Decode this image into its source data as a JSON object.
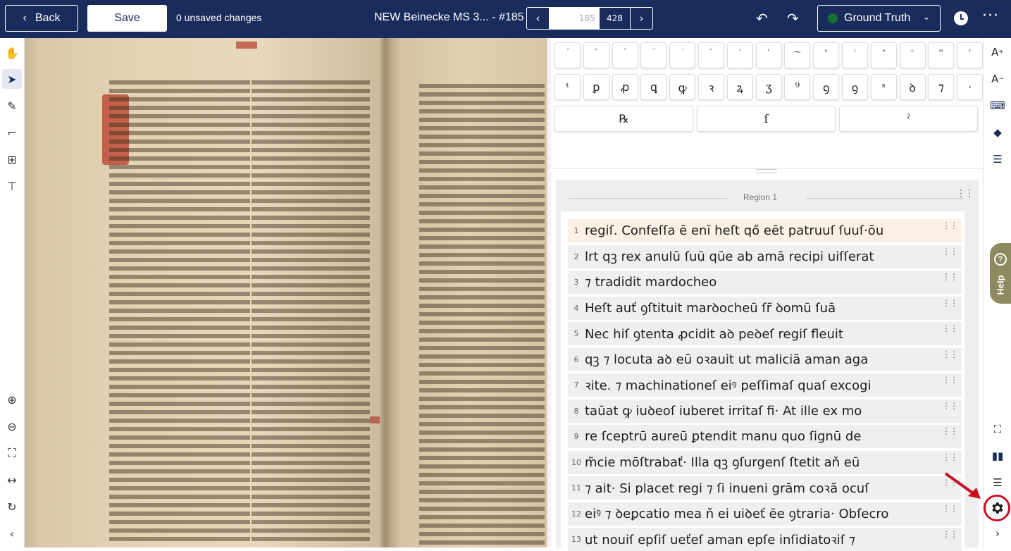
{
  "topbar": {
    "back_label": "Back",
    "save_label": "Save",
    "unsaved": "0 unsaved changes",
    "doc_title": "NEW Beinecke MS 3... - #185",
    "page_current": "185",
    "page_total": "428",
    "version_label": "Ground Truth",
    "colors": {
      "bar": "#1a2c5c",
      "status_dot": "#17702e"
    }
  },
  "left_tools": [
    "hand-icon",
    "pointer-icon",
    "pen-icon",
    "crop-icon",
    "region-icon",
    "baseline-icon",
    "zoom-in-icon",
    "zoom-out-icon",
    "fit-icon",
    "fit-width-icon",
    "rotate-icon",
    "collapse-icon"
  ],
  "keyboard": {
    "row1": [
      "´",
      "˜",
      "¯",
      "‾",
      "˙",
      "¨",
      "’",
      "ʾ",
      "⁓",
      "ᵉ",
      "ⁱ",
      "ᵒ",
      "ᶜ",
      "ᵐ",
      "ʳ"
    ],
    "row2": [
      "ᵗ",
      "ꝑ",
      "ꝓ",
      "ꝗ",
      "ꝙ",
      "ꝛ",
      "ꝝ",
      "ʒ",
      "⁹",
      "ꝯ",
      "ꝯ",
      "ˢ",
      "ꝺ",
      "⁊",
      "·"
    ],
    "row3": [
      "℞",
      "ſ",
      "ˀ"
    ]
  },
  "region": {
    "title": "Region 1",
    "lines": [
      {
        "num": "1",
        "text": "regiſ. Confeſſa ē enī heſt qő eēt patruuſ ſuuſ·ōu"
      },
      {
        "num": "2",
        "text": "lrt qꝫ rex anulū ſuū qūe ab amā recipi uiſſerat"
      },
      {
        "num": "3",
        "text": "⁊ tradidit mardocheo"
      },
      {
        "num": "4",
        "text": "Heſt auť ꝯſtituit marꝺocheū ſr̄ ꝺomū ſuā"
      },
      {
        "num": "5",
        "text": "Nec hiſ ꝯtenta ꝓcidit aꝺ peꝺeſ regiſ fleuit"
      },
      {
        "num": "6",
        "text": "qꝫ ⁊ locuta aꝺ eū oꝛauit ut maliciā aman aga"
      },
      {
        "num": "7",
        "text": "ꝛite. ⁊ machinationeſ eiꝰ peſſimaſ quaſ excogi"
      },
      {
        "num": "8",
        "text": "taūat ꝙ iuꝺeoſ iuberet irritaſ fi· At ille ex mo"
      },
      {
        "num": "9",
        "text": "re ſceptrū aureū ꝑtendit manu quo ſignū de"
      },
      {
        "num": "10",
        "text": "m̃cie mōſtrabať· Illa qꝫ ꝯſurgenſ ſtetit aň eū"
      },
      {
        "num": "11",
        "text": "⁊ ait· Si placet regi ⁊ ſi inueni grām coꝛā ocuſ"
      },
      {
        "num": "12",
        "text": "eiꝰ ⁊ ꝺeꝑcatio mea ň ei uiꝺeť ēe ꝯtraria· Obſecro"
      },
      {
        "num": "13",
        "text": "ut nouiſ epſiſ ueťeſ aman epſe inſidiatoꝛiſ ⁊"
      }
    ]
  },
  "right_tools": {
    "help_label": "Help"
  }
}
